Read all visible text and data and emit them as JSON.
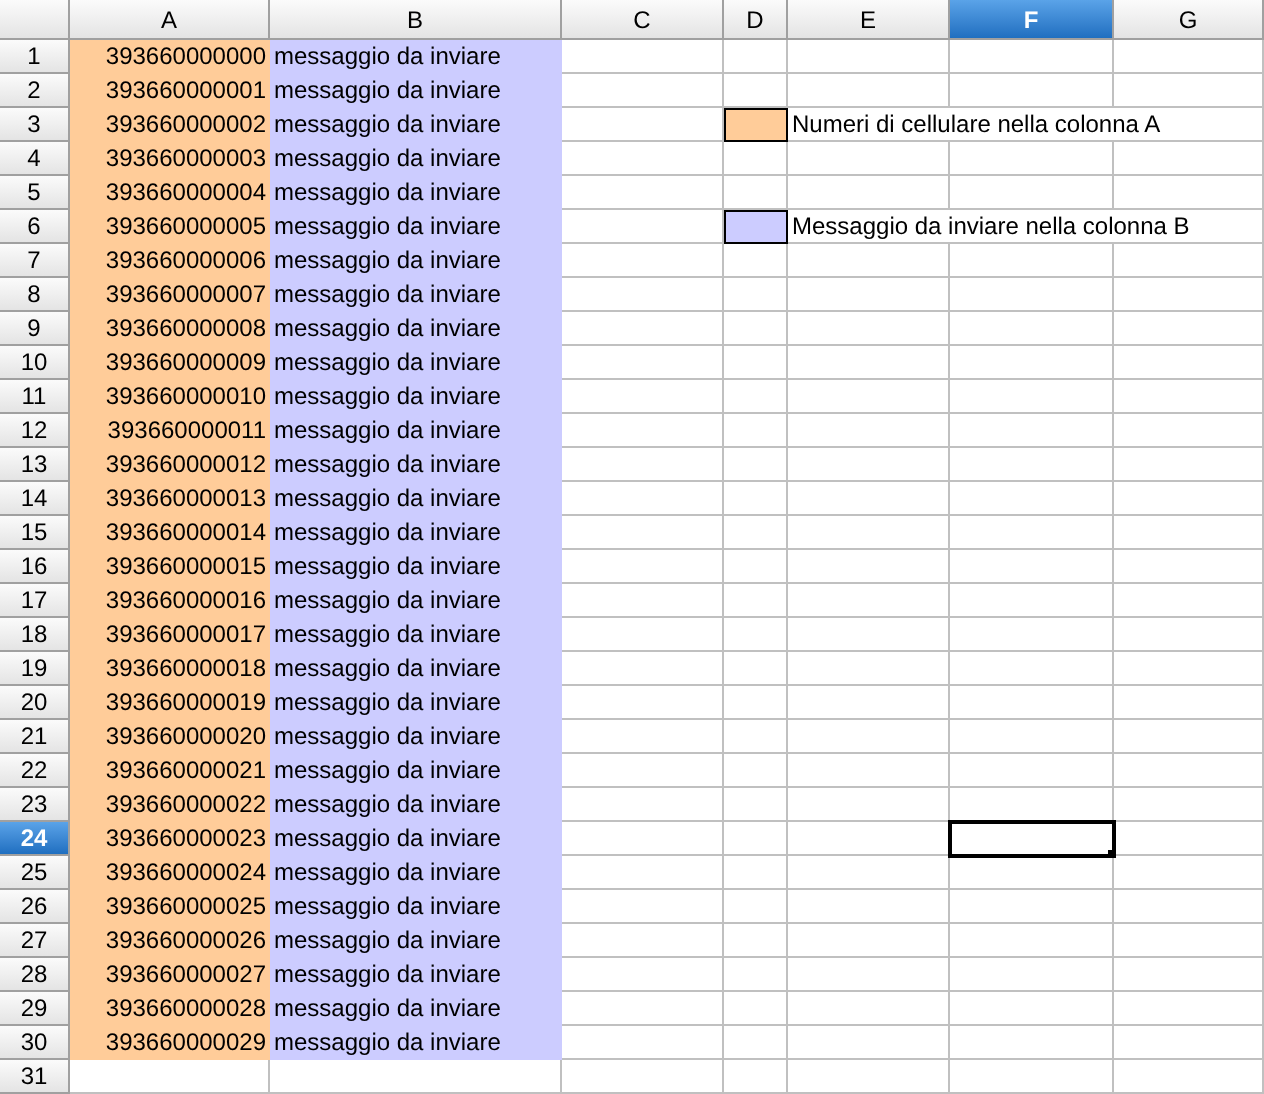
{
  "columns": [
    {
      "label": "A",
      "selected": false,
      "color": "#ffcc99"
    },
    {
      "label": "B",
      "selected": false,
      "color": "#ccccff"
    },
    {
      "label": "C",
      "selected": false
    },
    {
      "label": "D",
      "selected": false
    },
    {
      "label": "E",
      "selected": false
    },
    {
      "label": "F",
      "selected": true
    },
    {
      "label": "G",
      "selected": false
    }
  ],
  "rows": [
    {
      "label": "1",
      "selected": false,
      "cells": [
        "393660000000",
        "messaggio da inviare"
      ]
    },
    {
      "label": "2",
      "selected": false,
      "cells": [
        "393660000001",
        "messaggio da inviare"
      ]
    },
    {
      "label": "3",
      "selected": false,
      "cells": [
        "393660000002",
        "messaggio da inviare"
      ],
      "legend": {
        "color": "#ffcc99",
        "text": "Numeri di cellulare nella colonna A"
      }
    },
    {
      "label": "4",
      "selected": false,
      "cells": [
        "393660000003",
        "messaggio da inviare"
      ]
    },
    {
      "label": "5",
      "selected": false,
      "cells": [
        "393660000004",
        "messaggio da inviare"
      ]
    },
    {
      "label": "6",
      "selected": false,
      "cells": [
        "393660000005",
        "messaggio da inviare"
      ],
      "legend": {
        "color": "#ccccff",
        "text": "Messaggio da inviare nella colonna B"
      }
    },
    {
      "label": "7",
      "selected": false,
      "cells": [
        "393660000006",
        "messaggio da inviare"
      ]
    },
    {
      "label": "8",
      "selected": false,
      "cells": [
        "393660000007",
        "messaggio da inviare"
      ]
    },
    {
      "label": "9",
      "selected": false,
      "cells": [
        "393660000008",
        "messaggio da inviare"
      ]
    },
    {
      "label": "10",
      "selected": false,
      "cells": [
        "393660000009",
        "messaggio da inviare"
      ]
    },
    {
      "label": "11",
      "selected": false,
      "cells": [
        "393660000010",
        "messaggio da inviare"
      ]
    },
    {
      "label": "12",
      "selected": false,
      "cells": [
        "393660000011",
        "messaggio da inviare"
      ]
    },
    {
      "label": "13",
      "selected": false,
      "cells": [
        "393660000012",
        "messaggio da inviare"
      ]
    },
    {
      "label": "14",
      "selected": false,
      "cells": [
        "393660000013",
        "messaggio da inviare"
      ]
    },
    {
      "label": "15",
      "selected": false,
      "cells": [
        "393660000014",
        "messaggio da inviare"
      ]
    },
    {
      "label": "16",
      "selected": false,
      "cells": [
        "393660000015",
        "messaggio da inviare"
      ]
    },
    {
      "label": "17",
      "selected": false,
      "cells": [
        "393660000016",
        "messaggio da inviare"
      ]
    },
    {
      "label": "18",
      "selected": false,
      "cells": [
        "393660000017",
        "messaggio da inviare"
      ]
    },
    {
      "label": "19",
      "selected": false,
      "cells": [
        "393660000018",
        "messaggio da inviare"
      ]
    },
    {
      "label": "20",
      "selected": false,
      "cells": [
        "393660000019",
        "messaggio da inviare"
      ]
    },
    {
      "label": "21",
      "selected": false,
      "cells": [
        "393660000020",
        "messaggio da inviare"
      ]
    },
    {
      "label": "22",
      "selected": false,
      "cells": [
        "393660000021",
        "messaggio da inviare"
      ]
    },
    {
      "label": "23",
      "selected": false,
      "cells": [
        "393660000022",
        "messaggio da inviare"
      ]
    },
    {
      "label": "24",
      "selected": true,
      "cells": [
        "393660000023",
        "messaggio da inviare"
      ]
    },
    {
      "label": "25",
      "selected": false,
      "cells": [
        "393660000024",
        "messaggio da inviare"
      ]
    },
    {
      "label": "26",
      "selected": false,
      "cells": [
        "393660000025",
        "messaggio da inviare"
      ]
    },
    {
      "label": "27",
      "selected": false,
      "cells": [
        "393660000026",
        "messaggio da inviare"
      ]
    },
    {
      "label": "28",
      "selected": false,
      "cells": [
        "393660000027",
        "messaggio da inviare"
      ]
    },
    {
      "label": "29",
      "selected": false,
      "cells": [
        "393660000028",
        "messaggio da inviare"
      ]
    },
    {
      "label": "30",
      "selected": false,
      "cells": [
        "393660000029",
        "messaggio da inviare"
      ]
    },
    {
      "label": "31",
      "selected": false,
      "cells": []
    }
  ]
}
